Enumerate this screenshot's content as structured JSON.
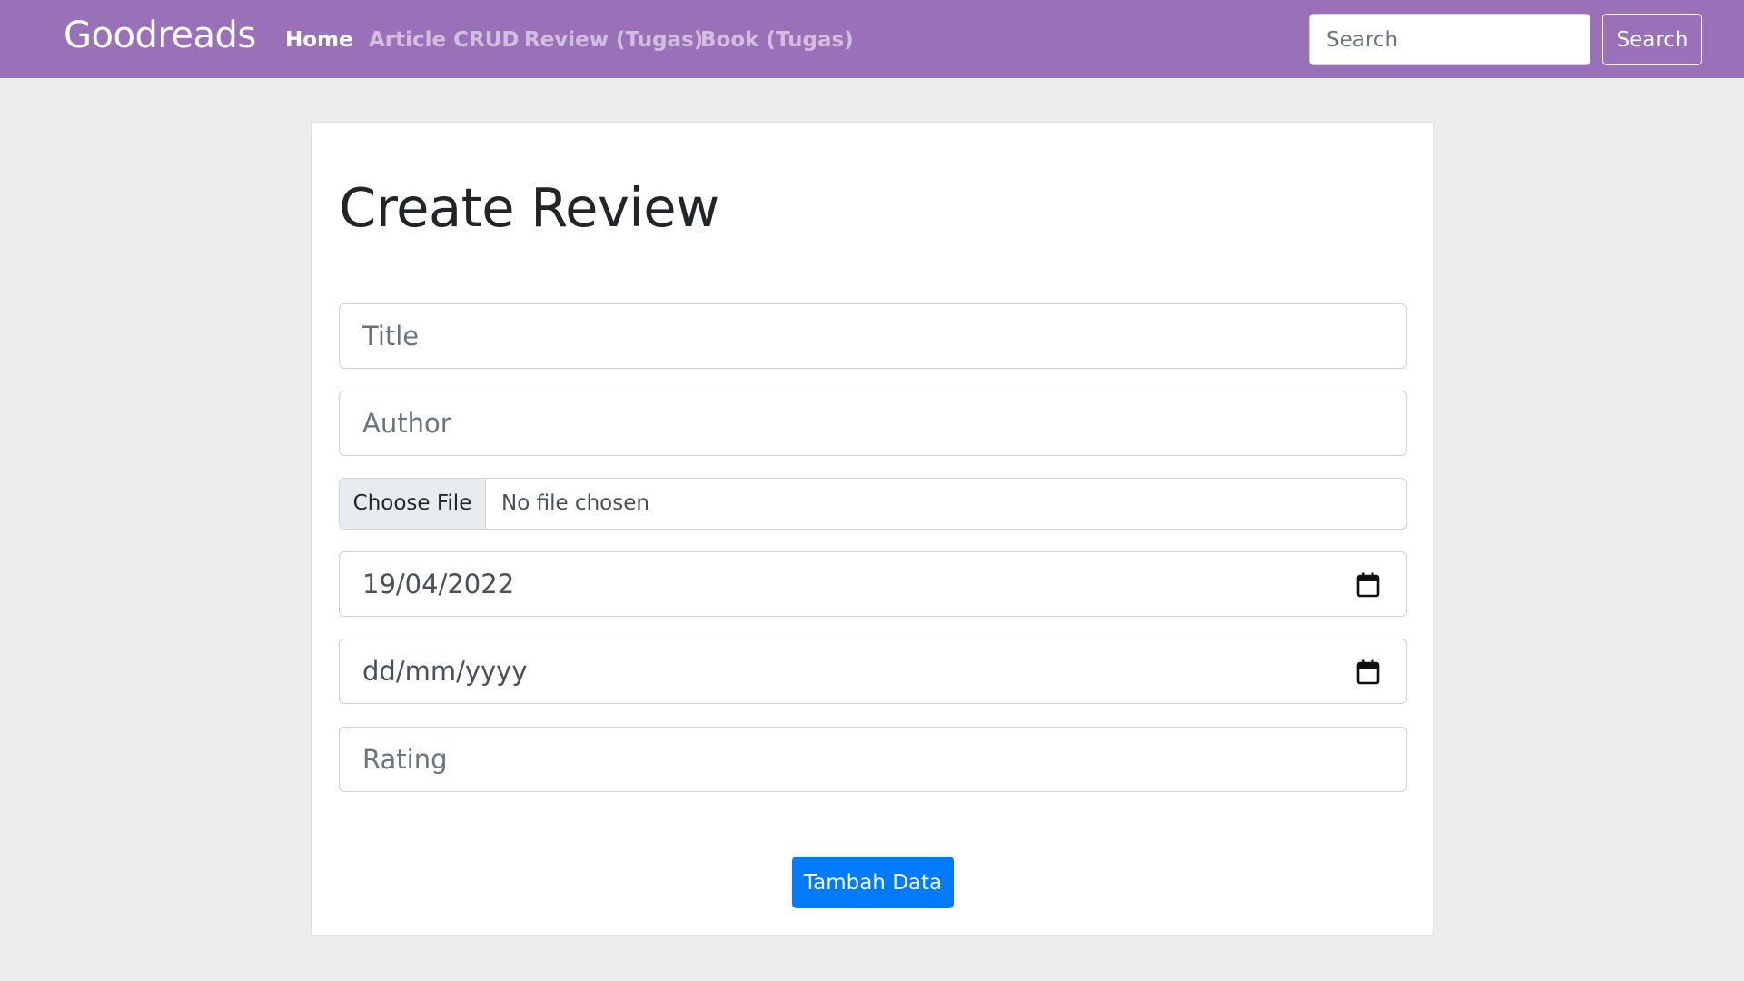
{
  "navbar": {
    "brand": "Goodreads",
    "links": [
      {
        "label": "Home",
        "active": true
      },
      {
        "label": "Article CRUD",
        "active": false
      },
      {
        "label": "Review (Tugas)",
        "active": false
      },
      {
        "label": "Book (Tugas)",
        "active": false
      }
    ],
    "search": {
      "placeholder": "Search",
      "value": "",
      "button_label": "Search"
    },
    "background_color": "#9a71b9"
  },
  "form": {
    "title": "Create Review",
    "title_field": {
      "placeholder": "Title",
      "value": ""
    },
    "author_field": {
      "placeholder": "Author",
      "value": ""
    },
    "file_field": {
      "button_label": "Choose File",
      "status": "No file chosen"
    },
    "start_date": {
      "value": "19/04/2022",
      "icon": "calendar-icon"
    },
    "end_date": {
      "value": "dd/mm/yyyy",
      "icon": "calendar-icon"
    },
    "rating_field": {
      "placeholder": "Rating",
      "value": ""
    },
    "submit_label": "Tambah Data",
    "accent_color": "#007bff"
  }
}
